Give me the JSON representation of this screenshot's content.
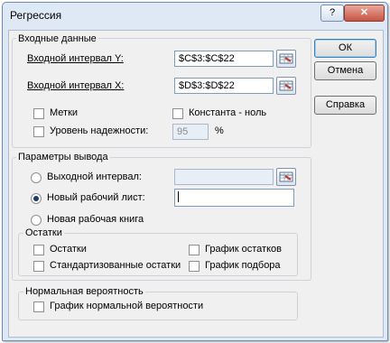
{
  "window": {
    "title": "Регрессия",
    "help_label": "?",
    "close_label": "✕"
  },
  "input": {
    "group_label": "Входные данные",
    "y_label": "Входной интервал Y:",
    "y_value": "$C$3:$C$22",
    "x_label": "Входной интервал X:",
    "x_value": "$D$3:$D$22",
    "labels_label": "Метки",
    "const_label": "Константа - ноль",
    "conf_label": "Уровень надежности:",
    "conf_value": "95",
    "percent": "%"
  },
  "output": {
    "group_label": "Параметры вывода",
    "range_label": "Выходной интервал:",
    "range_value": "",
    "new_sheet_label": "Новый рабочий лист:",
    "new_sheet_value": "",
    "new_book_label": "Новая рабочая книга",
    "selected": "new_sheet"
  },
  "residuals": {
    "group_label": "Остатки",
    "residuals_label": "Остатки",
    "std_residuals_label": "Стандартизованные остатки",
    "residual_plot_label": "График остатков",
    "fit_plot_label": "График подбора"
  },
  "normal": {
    "group_label": "Нормальная вероятность",
    "normal_plot_label": "График нормальной вероятности"
  },
  "buttons": {
    "ok": "ОК",
    "cancel": "Отмена",
    "help": "Справка"
  },
  "icons": {
    "range_picker": "range-picker-icon"
  }
}
